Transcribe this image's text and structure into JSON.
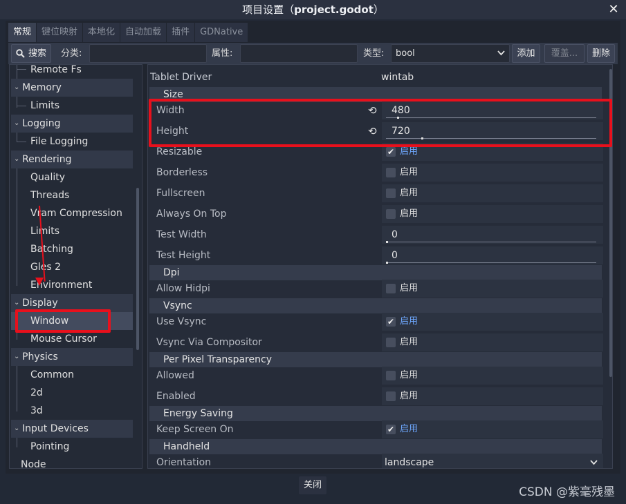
{
  "window": {
    "title_prefix": "项目设置（",
    "title_file": "project.godot",
    "title_suffix": "）",
    "close_glyph": "✕"
  },
  "tabs": [
    "常规",
    "键位映射",
    "本地化",
    "自动加载",
    "插件",
    "GDNative"
  ],
  "toolbar": {
    "search_icon": "search-icon",
    "search_label": "搜索",
    "category_label": "分类:",
    "category_value": "",
    "property_label": "属性:",
    "property_value": "",
    "type_label": "类型:",
    "type_value": "bool",
    "add_label": "添加",
    "override_label": "覆盖...",
    "delete_label": "删除"
  },
  "tree": [
    {
      "label": "Remote Fs",
      "kind": "child"
    },
    {
      "label": "Memory",
      "kind": "cat"
    },
    {
      "label": "Limits",
      "kind": "child"
    },
    {
      "label": "Logging",
      "kind": "cat"
    },
    {
      "label": "File Logging",
      "kind": "child"
    },
    {
      "label": "Rendering",
      "kind": "cat"
    },
    {
      "label": "Quality",
      "kind": "child"
    },
    {
      "label": "Threads",
      "kind": "child"
    },
    {
      "label": "Vram Compression",
      "kind": "child"
    },
    {
      "label": "Limits",
      "kind": "child"
    },
    {
      "label": "Batching",
      "kind": "child"
    },
    {
      "label": "Gles 2",
      "kind": "child"
    },
    {
      "label": "Environment",
      "kind": "child"
    },
    {
      "label": "Display",
      "kind": "cat"
    },
    {
      "label": "Window",
      "kind": "child",
      "selected": true
    },
    {
      "label": "Mouse Cursor",
      "kind": "child"
    },
    {
      "label": "Physics",
      "kind": "cat"
    },
    {
      "label": "Common",
      "kind": "child"
    },
    {
      "label": "2d",
      "kind": "child"
    },
    {
      "label": "3d",
      "kind": "child"
    },
    {
      "label": "Input Devices",
      "kind": "cat"
    },
    {
      "label": "Pointing",
      "kind": "child"
    },
    {
      "label": "Node",
      "kind": "cat"
    }
  ],
  "properties": {
    "tablet_driver": {
      "name": "Tablet Driver",
      "value": "wintab"
    },
    "size_section": "Size",
    "width": {
      "name": "Width",
      "value": "480",
      "slider": 0.05
    },
    "height": {
      "name": "Height",
      "value": "720",
      "slider": 0.17
    },
    "resizable": {
      "name": "Resizable",
      "checked": true,
      "label": "启用"
    },
    "borderless": {
      "name": "Borderless",
      "checked": false,
      "label": "启用"
    },
    "fullscreen": {
      "name": "Fullscreen",
      "checked": false,
      "label": "启用"
    },
    "always_on_top": {
      "name": "Always On Top",
      "checked": false,
      "label": "启用"
    },
    "test_width": {
      "name": "Test Width",
      "value": "0",
      "slider": 0
    },
    "test_height": {
      "name": "Test Height",
      "value": "0",
      "slider": 0
    },
    "dpi_section": "Dpi",
    "allow_hidpi": {
      "name": "Allow Hidpi",
      "checked": false,
      "label": "启用"
    },
    "vsync_section": "Vsync",
    "use_vsync": {
      "name": "Use Vsync",
      "checked": true,
      "label": "启用"
    },
    "vsync_via_compositor": {
      "name": "Vsync Via Compositor",
      "checked": false,
      "label": "启用"
    },
    "ppt_section": "Per Pixel Transparency",
    "allowed": {
      "name": "Allowed",
      "checked": false,
      "label": "启用"
    },
    "enabled": {
      "name": "Enabled",
      "checked": false,
      "label": "启用"
    },
    "energy_section": "Energy Saving",
    "keep_screen_on": {
      "name": "Keep Screen On",
      "checked": true,
      "label": "启用"
    },
    "handheld_section": "Handheld",
    "orientation": {
      "name": "Orientation",
      "value": "landscape"
    }
  },
  "footer": {
    "close_label": "关闭"
  },
  "watermark": "CSDN @紫毫残墨",
  "colors": {
    "highlight": "#e8101c",
    "checkbox_on_label": "#6ea8ff"
  }
}
